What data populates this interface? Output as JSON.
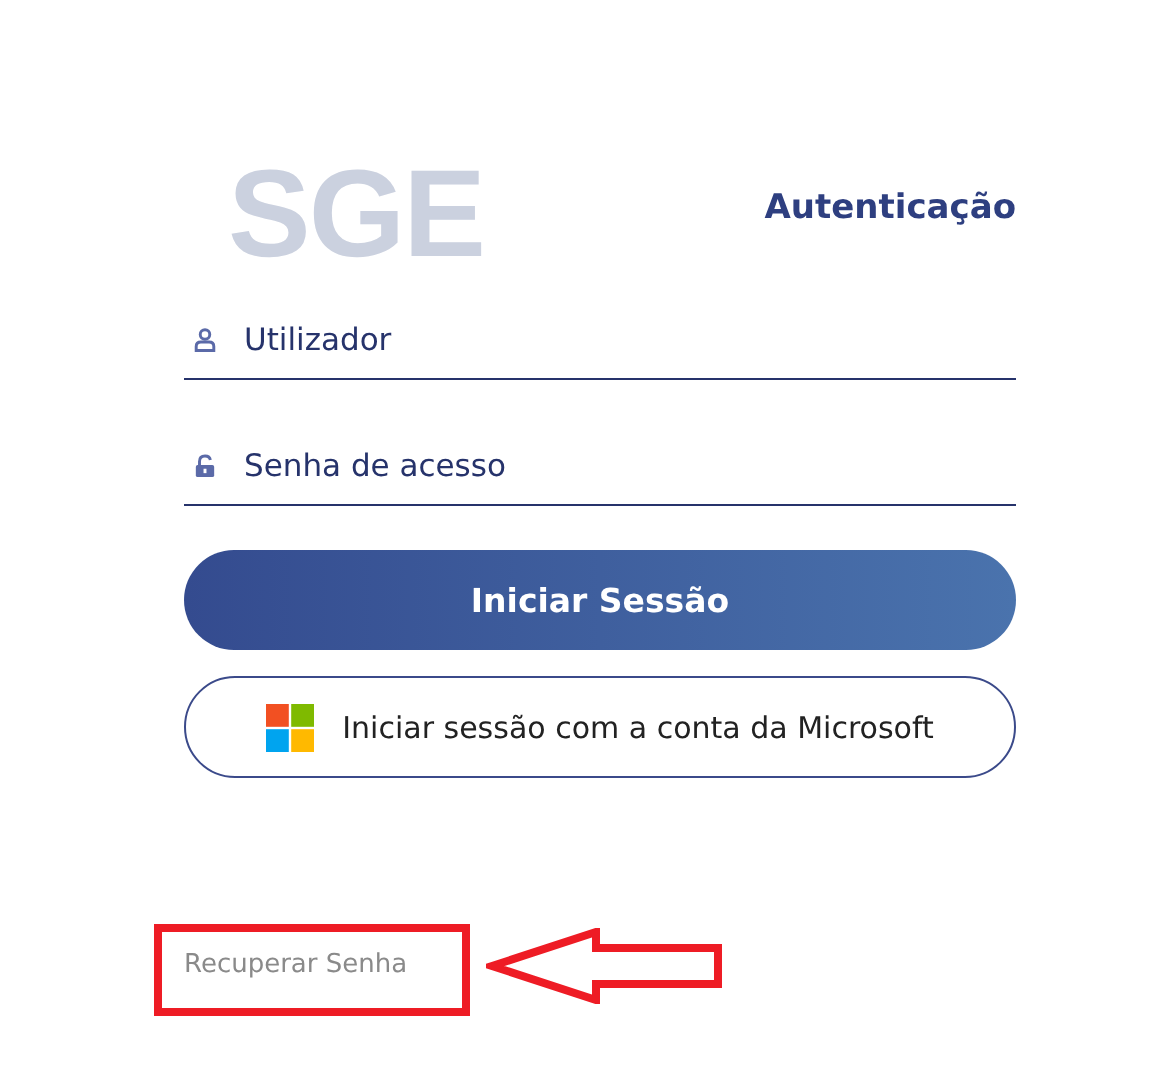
{
  "logo": {
    "text": "SGE"
  },
  "heading": "Autenticação",
  "fields": [
    {
      "kind": "user",
      "placeholder": "Utilizador"
    },
    {
      "kind": "password",
      "placeholder": "Senha de acesso"
    }
  ],
  "primary_button": "Iniciar Sessão",
  "microsoft_button": "Iniciar sessão com a conta da Microsoft",
  "recover_link": "Recuperar Senha"
}
